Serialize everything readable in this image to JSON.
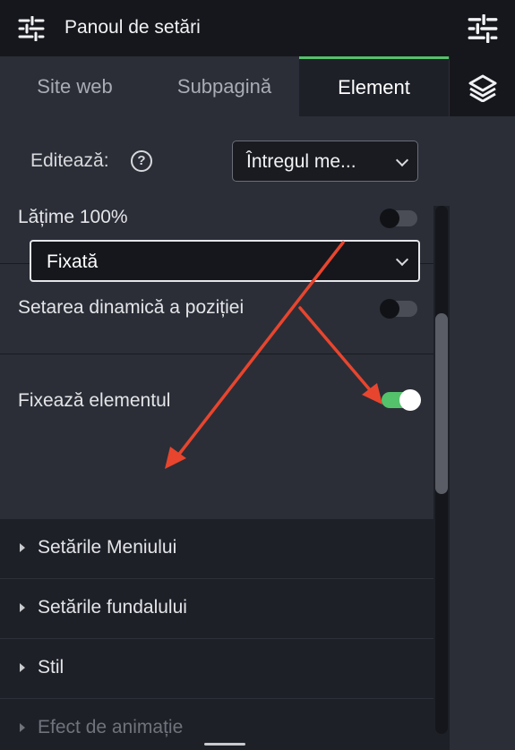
{
  "header": {
    "title": "Panoul de setări",
    "icon": "sliders-icon"
  },
  "rail": {
    "items": [
      {
        "icon": "sliders-icon"
      },
      {
        "icon": "layers-icon"
      }
    ]
  },
  "tabs": [
    {
      "label": "Site web",
      "active": false
    },
    {
      "label": "Subpagină",
      "active": false
    },
    {
      "label": "Element",
      "active": true
    }
  ],
  "edit": {
    "label": "Editează:",
    "help_icon": "?",
    "select_value": "Întregul me..."
  },
  "settings": {
    "full_width": {
      "label": "Lățime 100%",
      "enabled": false
    },
    "dynamic_position": {
      "label": "Setarea dinamică a poziției",
      "enabled": false
    },
    "pin_element": {
      "label": "Fixează elementul",
      "enabled": true,
      "mode": "Fixată"
    }
  },
  "sections": [
    {
      "label": "Setările Meniului"
    },
    {
      "label": "Setările fundalului"
    },
    {
      "label": "Stil"
    },
    {
      "label": "Efect de animație"
    }
  ],
  "colors": {
    "accent": "#53c26b",
    "annotation": "#e8452e",
    "panel": "#2b2e37",
    "background": "#1e2028"
  }
}
